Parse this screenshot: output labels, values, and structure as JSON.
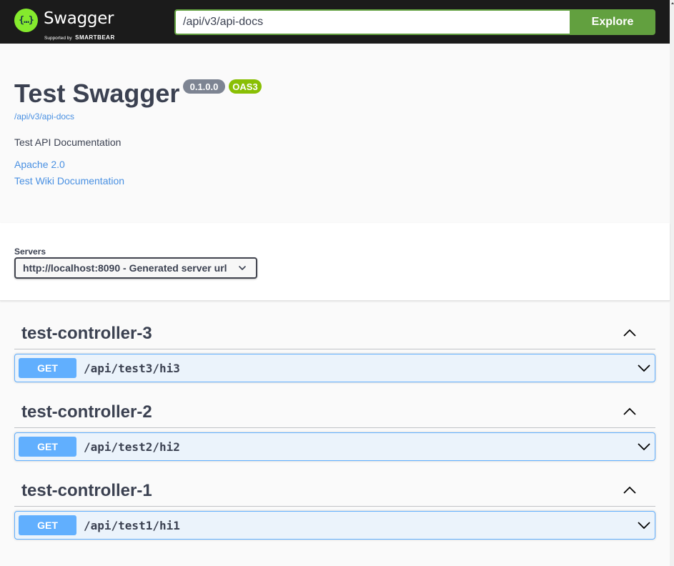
{
  "topbar": {
    "logo_mark": "{…}",
    "logo_name": "Swagger",
    "logo_sub_prefix": "Supported by",
    "logo_sub_brand": "SMARTBEAR",
    "url_value": "/api/v3/api-docs",
    "explore_label": "Explore",
    "accent_color": "#62a03f"
  },
  "info": {
    "title": "Test Swagger",
    "version": "0.1.0.0",
    "oas": "OAS3",
    "spec_url": "/api/v3/api-docs",
    "description": "Test API Documentation",
    "license_link": "Apache 2.0",
    "wiki_link": "Test Wiki Documentation"
  },
  "servers": {
    "label": "Servers",
    "selected": "http://localhost:8090 - Generated server url"
  },
  "tags": [
    {
      "name": "test-controller-3",
      "operation": {
        "method": "GET",
        "path": "/api/test3/hi3"
      }
    },
    {
      "name": "test-controller-2",
      "operation": {
        "method": "GET",
        "path": "/api/test2/hi2"
      }
    },
    {
      "name": "test-controller-1",
      "operation": {
        "method": "GET",
        "path": "/api/test1/hi1"
      }
    }
  ],
  "colors": {
    "get_method": "#61affe",
    "link": "#4990e2",
    "oas_badge": "#89bf04",
    "version_badge": "#7d8492"
  }
}
